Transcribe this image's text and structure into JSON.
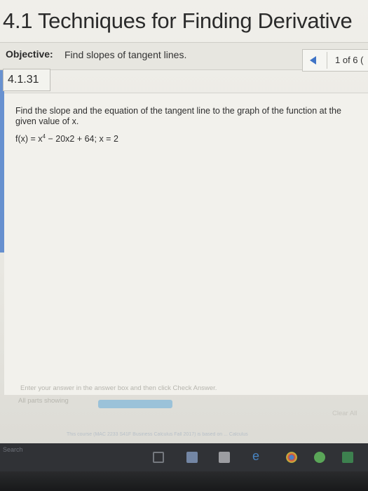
{
  "page": {
    "title": "4.1 Techniques for Finding Derivative"
  },
  "objective": {
    "label": "Objective:",
    "text": "Find slopes of tangent lines."
  },
  "pager": {
    "text": "1 of 6 ("
  },
  "problem": {
    "id": "4.1.31",
    "question": "Find the slope and the equation of the tangent line to the graph of the function at the given value of x.",
    "function_prefix": "f(x) = x",
    "function_exponent": "4",
    "function_suffix": " − 20x2 + 64; x = 2"
  },
  "answer_area": {
    "hint": "Enter your answer in the answer box and then click Check Answer.",
    "parts_label": "All parts showing",
    "clear_all_label": "Clear All"
  },
  "footer": {
    "text": "This course (MAC 2233 S41F Business Calculus Fall 2017) is based on ... Calculus"
  },
  "taskbar": {
    "search_label": "Search"
  },
  "colors": {
    "accent": "#3f74c6",
    "progress": "#8fbdd9",
    "taskbar": "#303236"
  }
}
